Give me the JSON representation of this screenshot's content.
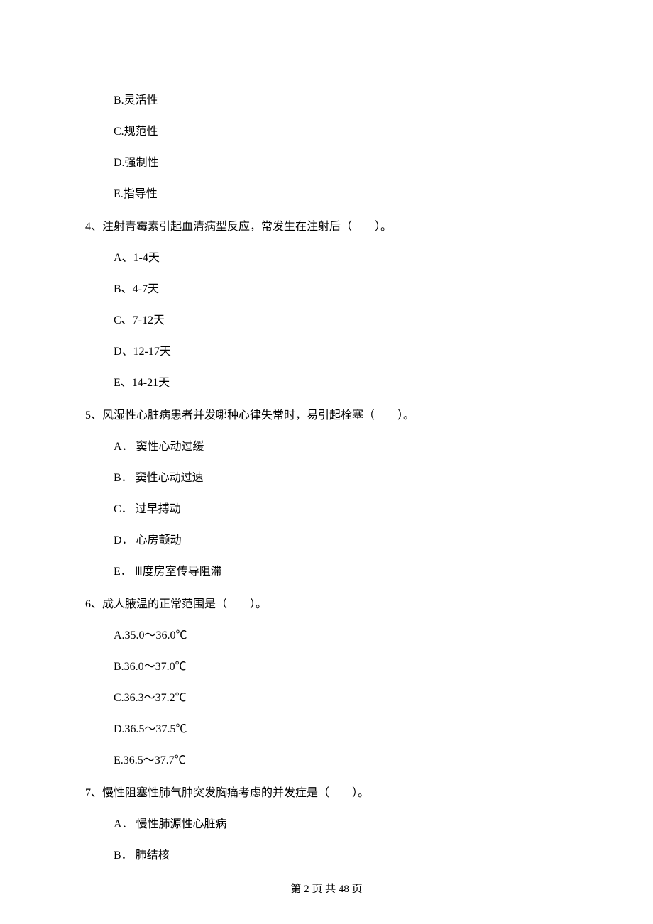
{
  "q3": {
    "options": {
      "B": "B.灵活性",
      "C": "C.规范性",
      "D": "D.强制性",
      "E": "E.指导性"
    }
  },
  "q4": {
    "text": "4、注射青霉素引起血清病型反应，常发生在注射后（　　）。",
    "options": {
      "A": "A、1-4天",
      "B": "B、4-7天",
      "C": "C、7-12天",
      "D": "D、12-17天",
      "E": "E、14-21天"
    }
  },
  "q5": {
    "text": "5、风湿性心脏病患者并发哪种心律失常时，易引起栓塞（　　）。",
    "options": {
      "A": "A． 窦性心动过缓",
      "B": "B． 窦性心动过速",
      "C": "C． 过早搏动",
      "D": "D． 心房颤动",
      "E": "E． Ⅲ度房室传导阻滞"
    }
  },
  "q6": {
    "text": "6、成人腋温的正常范围是（　　）。",
    "options": {
      "A": "A.35.0～36.0℃",
      "B": "B.36.0～37.0℃",
      "C": "C.36.3～37.2℃",
      "D": "D.36.5～37.5℃",
      "E": "E.36.5～37.7℃"
    }
  },
  "q7": {
    "text": "7、慢性阻塞性肺气肿突发胸痛考虑的并发症是（　　）。",
    "options": {
      "A": "A． 慢性肺源性心脏病",
      "B": "B． 肺结核"
    }
  },
  "footer": "第 2 页 共 48 页"
}
